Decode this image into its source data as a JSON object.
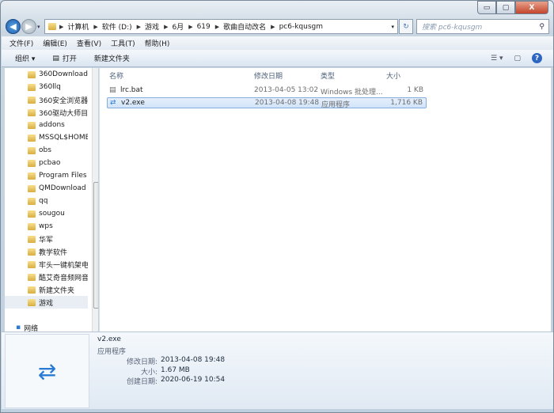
{
  "window": {
    "min": "▭",
    "max": "▢",
    "close": "X"
  },
  "address": {
    "crumbs": [
      "计算机",
      "软件 (D:)",
      "游戏",
      "6月",
      "619",
      "歌曲自动改名",
      "pc6-kqusgm"
    ]
  },
  "search": {
    "placeholder": "搜索 pc6-kqusgm"
  },
  "menu": [
    "文件(F)",
    "编辑(E)",
    "查看(V)",
    "工具(T)",
    "帮助(H)"
  ],
  "toolbar": {
    "organize": "组织 ▾",
    "open": "打开",
    "new_folder": "新建文件夹"
  },
  "sidebar": {
    "items": [
      "360Downloads",
      "360llq",
      "360安全浏览器下",
      "360驱动大师目录",
      "addons",
      "MSSQL$HOME",
      "obs",
      "pcbao",
      "Program Files (",
      "QMDownload",
      "qq",
      "sougou",
      "wps",
      "华军",
      "教学软件",
      "牢头一键机架电音",
      "酷艾奇音频网音效",
      "新建文件夹",
      "游戏"
    ],
    "selected": "游戏",
    "network": "网络"
  },
  "columns": {
    "name": "名称",
    "date": "修改日期",
    "type": "类型",
    "size": "大小"
  },
  "files": [
    {
      "name": "lrc.bat",
      "date": "2013-04-05 13:02",
      "type": "Windows 批处理...",
      "size": "1 KB",
      "icon": "batch-file-icon"
    },
    {
      "name": "v2.exe",
      "date": "2013-04-08 19:48",
      "type": "应用程序",
      "size": "1,716 KB",
      "icon": "exe-refresh-icon",
      "selected": true
    }
  ],
  "details": {
    "name": "v2.exe",
    "kind": "应用程序",
    "modified_label": "修改日期:",
    "modified": "2013-04-08 19:48",
    "size_label": "大小:",
    "size": "1.67 MB",
    "created_label": "创建日期:",
    "created": "2020-06-19 10:54"
  }
}
